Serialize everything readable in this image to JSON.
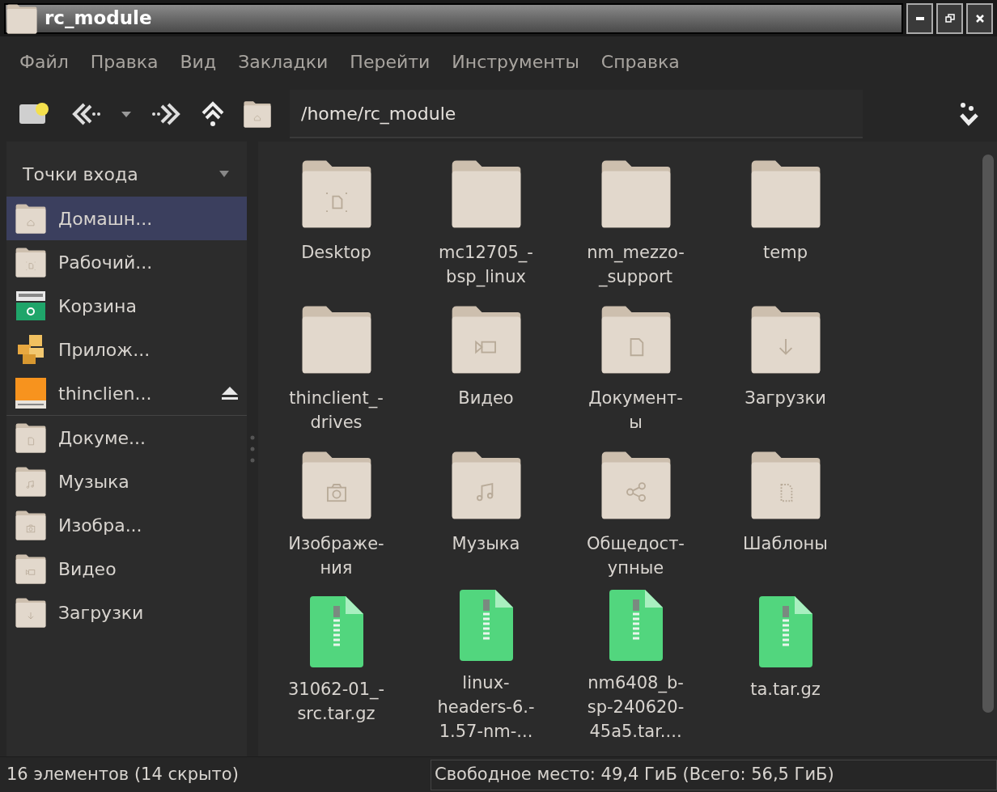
{
  "window": {
    "title": "rc_module"
  },
  "menu": [
    "Файл",
    "Правка",
    "Вид",
    "Закладки",
    "Перейти",
    "Инструменты",
    "Справка"
  ],
  "location": {
    "value": "/home/rc_module"
  },
  "sidebar": {
    "header": "Точки входа",
    "items": [
      {
        "label": "Домашн...",
        "kind": "home",
        "selected": true,
        "eject": false
      },
      {
        "label": "Рабочий...",
        "kind": "desktop",
        "selected": false,
        "eject": false
      },
      {
        "label": "Корзина",
        "kind": "trash",
        "selected": false,
        "eject": false
      },
      {
        "label": "Прилож...",
        "kind": "apps",
        "selected": false,
        "eject": false
      },
      {
        "label": "thinclien...",
        "kind": "drive",
        "selected": false,
        "eject": true
      },
      {
        "label": "Докуме...",
        "kind": "document",
        "selected": false,
        "eject": false
      },
      {
        "label": "Музыка",
        "kind": "music",
        "selected": false,
        "eject": false
      },
      {
        "label": "Изобра...",
        "kind": "camera",
        "selected": false,
        "eject": false
      },
      {
        "label": "Видео",
        "kind": "video",
        "selected": false,
        "eject": false
      },
      {
        "label": "Загрузки",
        "kind": "download",
        "selected": false,
        "eject": false
      }
    ]
  },
  "files": [
    {
      "lines": [
        "Desktop"
      ],
      "kind": "desktop"
    },
    {
      "lines": [
        "mc12705_-",
        "bsp_linux"
      ],
      "kind": "folder"
    },
    {
      "lines": [
        "nm_mezzo-",
        "_support"
      ],
      "kind": "folder"
    },
    {
      "lines": [
        "temp"
      ],
      "kind": "folder"
    },
    {
      "lines": [
        "thinclient_-",
        "drives"
      ],
      "kind": "folder"
    },
    {
      "lines": [
        "Видео"
      ],
      "kind": "video"
    },
    {
      "lines": [
        "Документ-",
        "ы"
      ],
      "kind": "document"
    },
    {
      "lines": [
        "Загрузки"
      ],
      "kind": "download"
    },
    {
      "lines": [
        "Изображе-",
        "ния"
      ],
      "kind": "camera"
    },
    {
      "lines": [
        "Музыка"
      ],
      "kind": "music"
    },
    {
      "lines": [
        "Общедост-",
        "упные"
      ],
      "kind": "share"
    },
    {
      "lines": [
        "Шаблоны"
      ],
      "kind": "template"
    },
    {
      "lines": [
        "31062-01_-",
        "src.tar.gz"
      ],
      "kind": "archive"
    },
    {
      "lines": [
        "linux-",
        "headers-6.-",
        "1.57-nm-..."
      ],
      "kind": "archive"
    },
    {
      "lines": [
        "nm6408_b-",
        "sp-240620-",
        "45a5.tar...."
      ],
      "kind": "archive"
    },
    {
      "lines": [
        "ta.tar.gz"
      ],
      "kind": "archive"
    }
  ],
  "status_bar": {
    "count": "16 элементов (14 скрыто)",
    "space": "Свободное место: 49,4 ГиБ (Всего: 56,5 ГиБ)"
  }
}
